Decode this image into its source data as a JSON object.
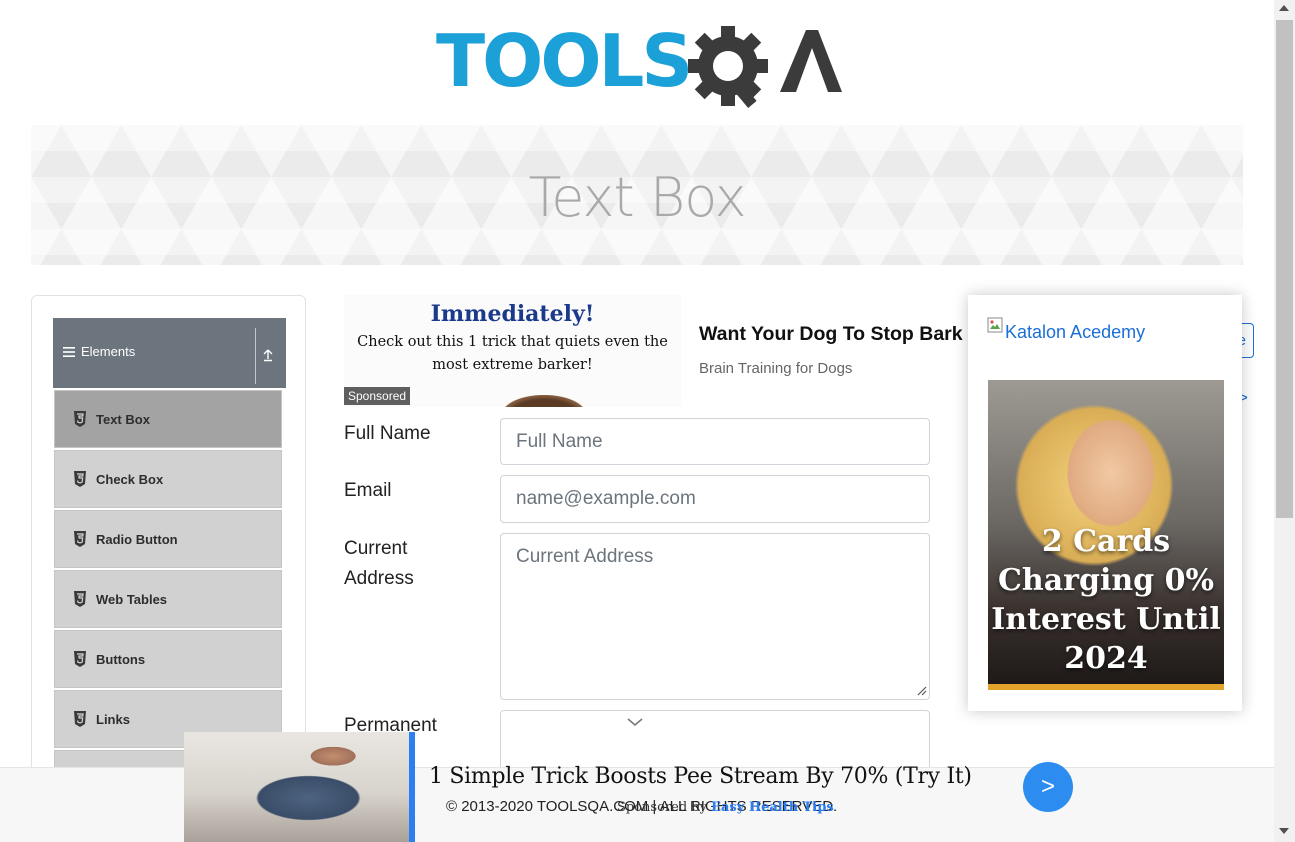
{
  "header": {
    "logo_text": "TOOLSQA"
  },
  "banner": {
    "title": "Text Box"
  },
  "sidebar": {
    "group_title": "Elements",
    "items": [
      {
        "label": "Text Box",
        "icon": "html5-icon",
        "active": true
      },
      {
        "label": "Check Box",
        "icon": "html5-icon"
      },
      {
        "label": "Radio Button",
        "icon": "html5-icon"
      },
      {
        "label": "Web Tables",
        "icon": "html5-icon"
      },
      {
        "label": "Buttons",
        "icon": "html5-icon"
      },
      {
        "label": "Links",
        "icon": "html5-icon"
      }
    ]
  },
  "ad_top": {
    "headline": "Immediately!",
    "body": "Check out this 1 trick that quiets even the most extreme barker!",
    "badge": "Sponsored",
    "right_headline": "Want Your Dog To Stop Bark",
    "right_sub": "Brain Training for Dogs",
    "right_button": "e",
    "right_chevron": ">"
  },
  "form": {
    "full_name": {
      "label": "Full Name",
      "placeholder": "Full Name",
      "value": ""
    },
    "email": {
      "label": "Email",
      "placeholder": "name@example.com",
      "value": ""
    },
    "current_address": {
      "label_line1": "Current",
      "label_line2": "Address",
      "placeholder": "Current Address",
      "value": ""
    },
    "permanent_address": {
      "label": "Permanent"
    }
  },
  "side_ad": {
    "link_text": "Katalon Acedemy",
    "image_text_lines": [
      "2 Cards",
      "Charging 0%",
      "Interest Until",
      "2024"
    ],
    "accent": "#e4a32b"
  },
  "bottom_ad": {
    "headline": "1 Simple Trick Boosts Pee Stream By 70% (Try It)",
    "sponsored_prefix": "Sponsored by ",
    "sponsor_name": "Easy Health Tips",
    "go_button": ">"
  },
  "footer": {
    "text": "© 2013-2020 TOOLSQA.COM | ALL RIGHTS RESERVED."
  },
  "colors": {
    "brand_blue": "#1ba0d8",
    "brand_dark": "#3b3b3b",
    "sidebar_header": "#6c757d",
    "ad_blue": "#2d8cf0"
  }
}
